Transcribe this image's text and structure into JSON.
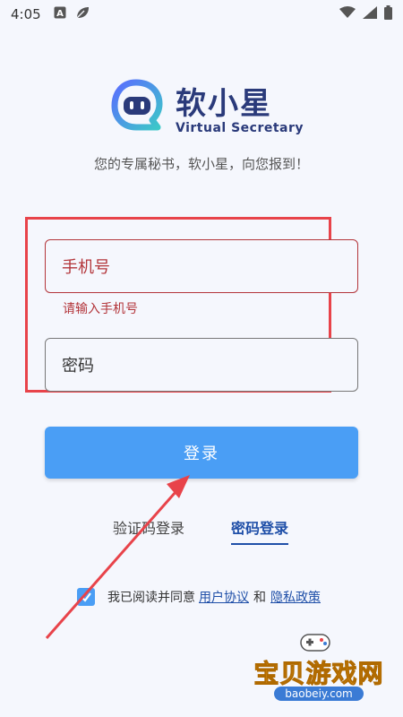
{
  "status_bar": {
    "time": "4:05",
    "icons": [
      "a-badge-icon",
      "leaf-icon",
      "wifi-icon",
      "signal-icon",
      "battery-icon"
    ]
  },
  "brand": {
    "name": "软小星",
    "subtitle": "Virtual Secretary",
    "slogan": "您的专属秘书，软小星，向您报到！",
    "colors": {
      "primary": "#2a3a7a",
      "accent_left": "#5a6cff",
      "accent_right": "#3cc8c8"
    }
  },
  "form": {
    "phone_placeholder": "手机号",
    "phone_error": "请输入手机号",
    "password_placeholder": "密码",
    "error_color": "#b3353a"
  },
  "login_button": {
    "label": "登录",
    "color": "#4a9ef5"
  },
  "tabs": [
    {
      "label": "验证码登录",
      "active": false
    },
    {
      "label": "密码登录",
      "active": true
    }
  ],
  "agreement": {
    "checked": true,
    "prefix": "我已阅读并同意",
    "user_agreement": "用户协议",
    "and": "和",
    "privacy_policy": "隐私政策"
  },
  "watermark": {
    "text": "宝贝游戏网",
    "url": "baobeiy.com"
  }
}
